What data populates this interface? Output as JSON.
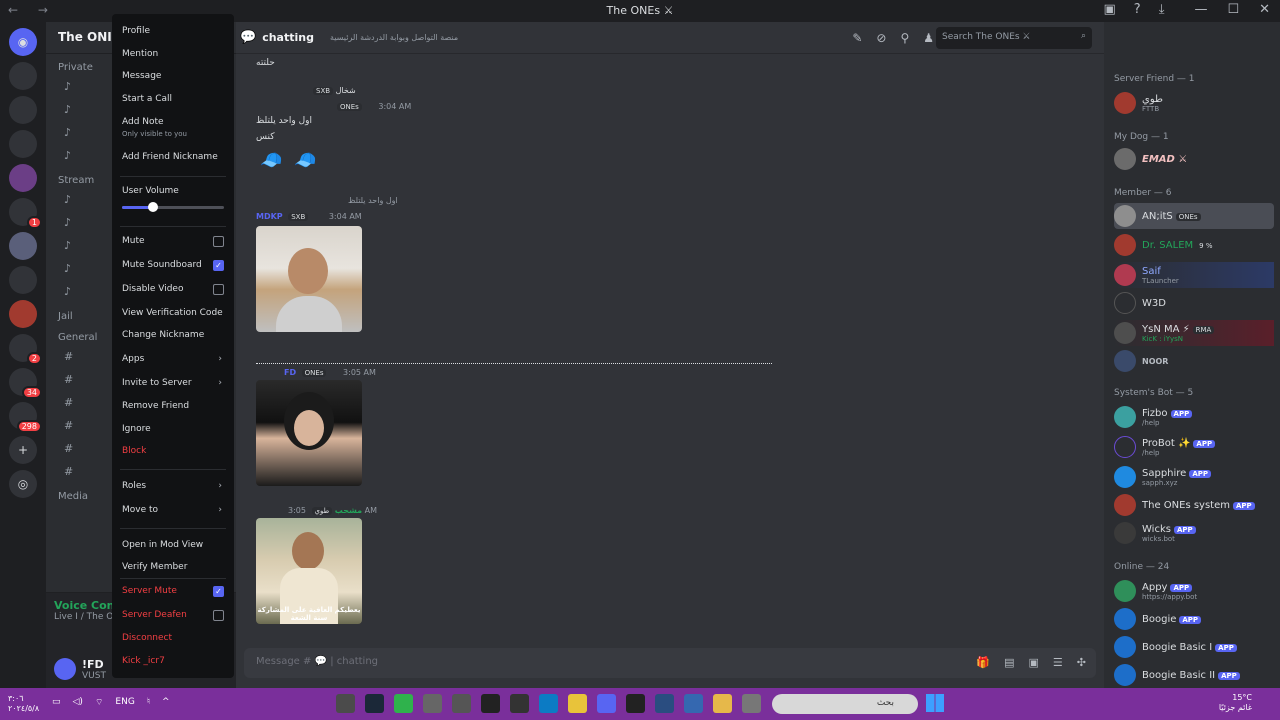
{
  "window": {
    "title": "The ONEs ⚔"
  },
  "server": {
    "name": "The ONI",
    "categories": [
      "Private",
      "Stream",
      "Jail",
      "General",
      "Media"
    ]
  },
  "channel": {
    "name": "chatting",
    "topic": "منصة التواصل وبوابة الدردشة الرئيسية"
  },
  "search": {
    "placeholder": "Search The ONEs ⚔"
  },
  "context_menu": {
    "profile": "Profile",
    "mention": "Mention",
    "message": "Message",
    "start_call": "Start a Call",
    "add_note": "Add Note",
    "add_note_sub": "Only visible to you",
    "add_friend_nickname": "Add Friend Nickname",
    "user_volume": "User Volume",
    "user_volume_percent": 30,
    "mute": "Mute",
    "mute_soundboard": "Mute Soundboard",
    "disable_video": "Disable Video",
    "view_verification_code": "View Verification Code",
    "change_nickname": "Change Nickname",
    "apps": "Apps",
    "invite_to_server": "Invite to Server",
    "remove_friend": "Remove Friend",
    "ignore": "Ignore",
    "block": "Block",
    "roles": "Roles",
    "move_to": "Move to",
    "open_mod_view": "Open in Mod View",
    "verify_member": "Verify Member",
    "server_mute": "Server Mute",
    "server_deafen": "Server Deafen",
    "disconnect": "Disconnect",
    "kick": "Kick _icr7"
  },
  "messages": {
    "m0": "حلتته",
    "m1_user": "شخال",
    "m1_tag": "SXB",
    "m1_tag2": "ONEs",
    "m1_time": "3:04 AM",
    "m1_text": "اول واحد يلتلظ",
    "m1_text2": "كنس",
    "m2_reply": "اول واحد يلتلظ",
    "m2_user": "MDKP",
    "m2_tag": "SXB",
    "m2_time": "3:04 AM",
    "m3_user": "FD",
    "m3_tag": "ONEs",
    "m3_time": "3:05 AM",
    "m4_user": "مشحب",
    "m4_tag": "طوي",
    "m4_time": "3:05 AM",
    "m4_caption": "يعطيكم العافية على المشاركة سنة الشعة"
  },
  "composer": {
    "placeholder": "Message # 💬 | chatting"
  },
  "voice": {
    "status": "Voice Connected",
    "channel": "Live I / The ONE"
  },
  "user": {
    "name": "!FD",
    "status": "VUST"
  },
  "members": {
    "server_friend": "Server Friend — 1",
    "sf1": "طوي",
    "sf1_sub": "FTTB",
    "my_dog": "My Dog — 1",
    "md1": "EMAD ⚔",
    "member": "Member — 6",
    "mb1": "AN;itS",
    "mb1_tag": "ONEs",
    "mb2": "Dr. SALEM",
    "mb2_tag": "9 %",
    "mb3": "Saif",
    "mb3_sub": "TLauncher",
    "mb4": "W3D",
    "mb5": "YsN MA ⚡",
    "mb5_tag": "RMA",
    "mb5_sub": "KicK : iYysN",
    "mb6": "NOOR",
    "bots": "System's Bot — 5",
    "b1": "Fizbo",
    "b1_sub": "/help",
    "b2": "ProBot ✨",
    "b2_sub": "/help",
    "b3": "Sapphire",
    "b3_sub": "sapph.xyz",
    "b4": "The ONEs system",
    "b5": "Wicks",
    "b5_sub": "wicks.bot",
    "online": "Online — 24",
    "o1": "Appy",
    "o1_sub": "https://appy.bot",
    "o2": "Boogie",
    "o3": "Boogie Basic I",
    "o4": "Boogie Basic II",
    "app_label": "APP"
  },
  "taskbar": {
    "time": "٣:٠٦",
    "date": "٢٠٢٤/٥/٨",
    "lang": "ENG",
    "search": "بحث",
    "temp": "15°C",
    "weather": "غائم جزئيًا"
  }
}
